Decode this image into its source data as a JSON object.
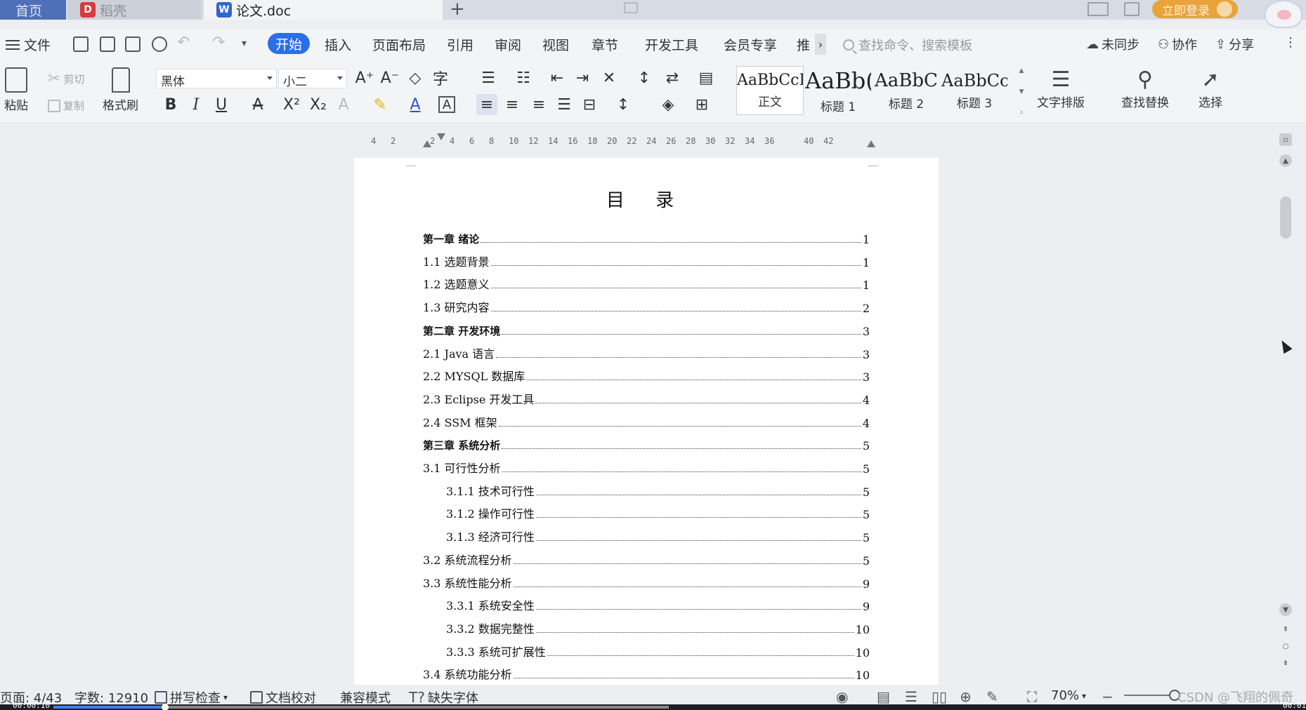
{
  "tabs": {
    "home": "首页",
    "daoke": "稻壳",
    "doc": "论文.doc"
  },
  "titlebar": {
    "login_label": "立即登录"
  },
  "menu": {
    "file": "文件",
    "items": [
      "开始",
      "插入",
      "页面布局",
      "引用",
      "审阅",
      "视图",
      "章节",
      "开发工具",
      "会员专享",
      "推"
    ],
    "search_placeholder": "查找命令、搜索模板",
    "unsynced": "未同步",
    "collab": "协作",
    "share": "分享"
  },
  "ribbon": {
    "paste": "粘贴",
    "cut": "剪切",
    "copy": "复制",
    "format_painter": "格式刷",
    "font_name": "黑体",
    "font_size": "小二",
    "styles": [
      {
        "sample": "AaBbCcI",
        "name": "正文"
      },
      {
        "sample": "AaBb(",
        "name": "标题 1"
      },
      {
        "sample": "AaBbC",
        "name": "标题 2"
      },
      {
        "sample": "AaBbCc",
        "name": "标题 3"
      }
    ],
    "text_layout": "文字排版",
    "find_replace": "查找替换",
    "select": "选择"
  },
  "ruler": {
    "ticks": [
      "4",
      "2",
      "2",
      "4",
      "6",
      "8",
      "10",
      "12",
      "14",
      "16",
      "18",
      "20",
      "22",
      "24",
      "26",
      "28",
      "30",
      "32",
      "34",
      "36",
      "40",
      "42"
    ]
  },
  "document": {
    "toc_title": "目 录",
    "toc": [
      {
        "label": "第一章 绪论",
        "page": "1",
        "level": 1
      },
      {
        "label": "1.1 选题背景",
        "page": "1",
        "level": 2
      },
      {
        "label": "1.2 选题意义",
        "page": "1",
        "level": 2
      },
      {
        "label": "1.3 研究内容",
        "page": "2",
        "level": 2
      },
      {
        "label": "第二章 开发环境",
        "page": "3",
        "level": 1
      },
      {
        "label": "2.1 Java 语言",
        "page": "3",
        "level": 2
      },
      {
        "label": "2.2 MYSQL 数据库",
        "page": "3",
        "level": 2
      },
      {
        "label": "2.3 Eclipse 开发工具",
        "page": "4",
        "level": 2
      },
      {
        "label": "2.4 SSM 框架",
        "page": "4",
        "level": 2
      },
      {
        "label": "第三章 系统分析",
        "page": "5",
        "level": 1
      },
      {
        "label": "3.1 可行性分析",
        "page": "5",
        "level": 2
      },
      {
        "label": "3.1.1 技术可行性",
        "page": "5",
        "level": 3
      },
      {
        "label": "3.1.2 操作可行性",
        "page": "5",
        "level": 3
      },
      {
        "label": "3.1.3 经济可行性",
        "page": "5",
        "level": 3
      },
      {
        "label": "3.2 系统流程分析",
        "page": "5",
        "level": 2
      },
      {
        "label": "3.3 系统性能分析",
        "page": "9",
        "level": 2
      },
      {
        "label": "3.3.1 系统安全性",
        "page": "9",
        "level": 3
      },
      {
        "label": "3.3.2 数据完整性",
        "page": "10",
        "level": 3
      },
      {
        "label": "3.3.3 系统可扩展性",
        "page": "10",
        "level": 3
      },
      {
        "label": "3.4 系统功能分析",
        "page": "10",
        "level": 2
      }
    ]
  },
  "status": {
    "page": "页面: 4/43",
    "words": "字数: 12910",
    "spellcheck": "拼写检查",
    "proofread": "文档校对",
    "compat": "兼容模式",
    "missing_font": "缺失字体",
    "zoom": "70%"
  },
  "video": {
    "elapsed": "00:00:10",
    "total": "00:01"
  },
  "watermark": "CSDN @飞翔的佩奇",
  "colors": {
    "accent": "#2a6fe8",
    "login": "#e9a33a",
    "home_tab": "#4f6fb8"
  }
}
